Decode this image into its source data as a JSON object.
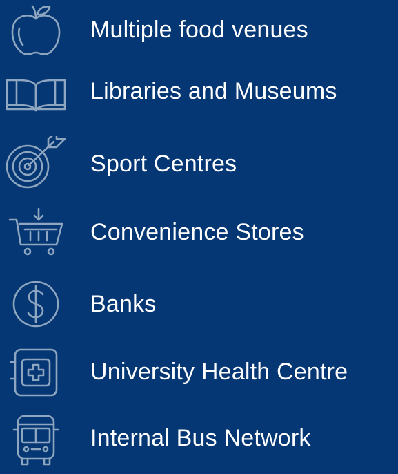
{
  "background_color": "#053774",
  "icon_color": "#8ea6bf",
  "text_color": "#ffffff",
  "amenities": [
    {
      "icon": "apple-icon",
      "label": "Multiple food venues"
    },
    {
      "icon": "book-icon",
      "label": "Libraries and Museums"
    },
    {
      "icon": "target-icon",
      "label": "Sport Centres"
    },
    {
      "icon": "shopping-cart-icon",
      "label": "Convenience Stores"
    },
    {
      "icon": "dollar-coin-icon",
      "label": "Banks"
    },
    {
      "icon": "first-aid-kit-icon",
      "label": "University Health Centre"
    },
    {
      "icon": "bus-icon",
      "label": "Internal Bus Network"
    }
  ]
}
